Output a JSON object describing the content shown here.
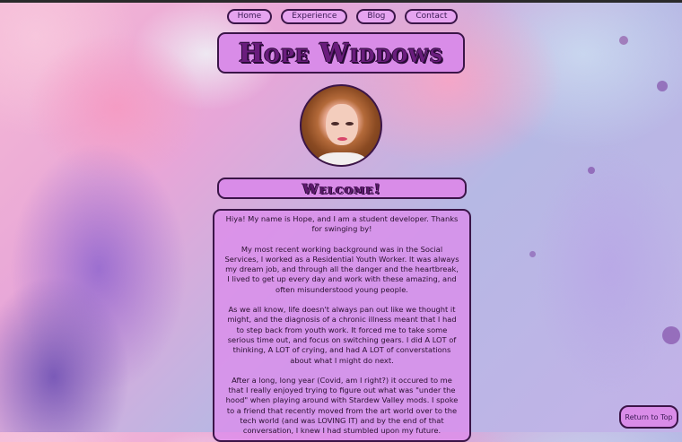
{
  "nav": {
    "items": [
      {
        "label": "Home"
      },
      {
        "label": "Experience"
      },
      {
        "label": "Blog"
      },
      {
        "label": "Contact"
      }
    ]
  },
  "header": {
    "title": "Hope Widdows"
  },
  "welcome": {
    "heading": "Welcome!"
  },
  "about": {
    "paragraphs": [
      "Hiya! My name is Hope, and I am a student developer. Thanks for swinging by!",
      "My most recent working background was in the Social Services, I worked as a Residential Youth Worker. It was always my dream job, and through all the danger and the heartbreak, I lived to get up every day and work with these amazing, and often misunderstood young people.",
      "As we all know, life doesn't always pan out like we thought it might, and the diagnosis of a chronic illness meant that I had to step back from youth work. It forced me to take some serious time out, and focus on switching gears. I did A LOT of thinking, A LOT of crying, and had A LOT of converstations about what I might do next.",
      "After a long, long year (Covid, am I right?) it occured to me that I really enjoyed trying to figure out what was \"under the hood\" when playing around with Stardew Valley mods. I spoke to a friend that recently moved from the art world over to the tech world (and was LOVING IT) and by the end of that conversation, I knew I had stumbled upon my future."
    ]
  },
  "footer": {
    "return_label": "Return to Top"
  },
  "colors": {
    "box": "#d98ce8",
    "border": "#3b1548",
    "title_text": "#6a1d7d"
  },
  "icons": {
    "avatar": "profile-photo"
  }
}
